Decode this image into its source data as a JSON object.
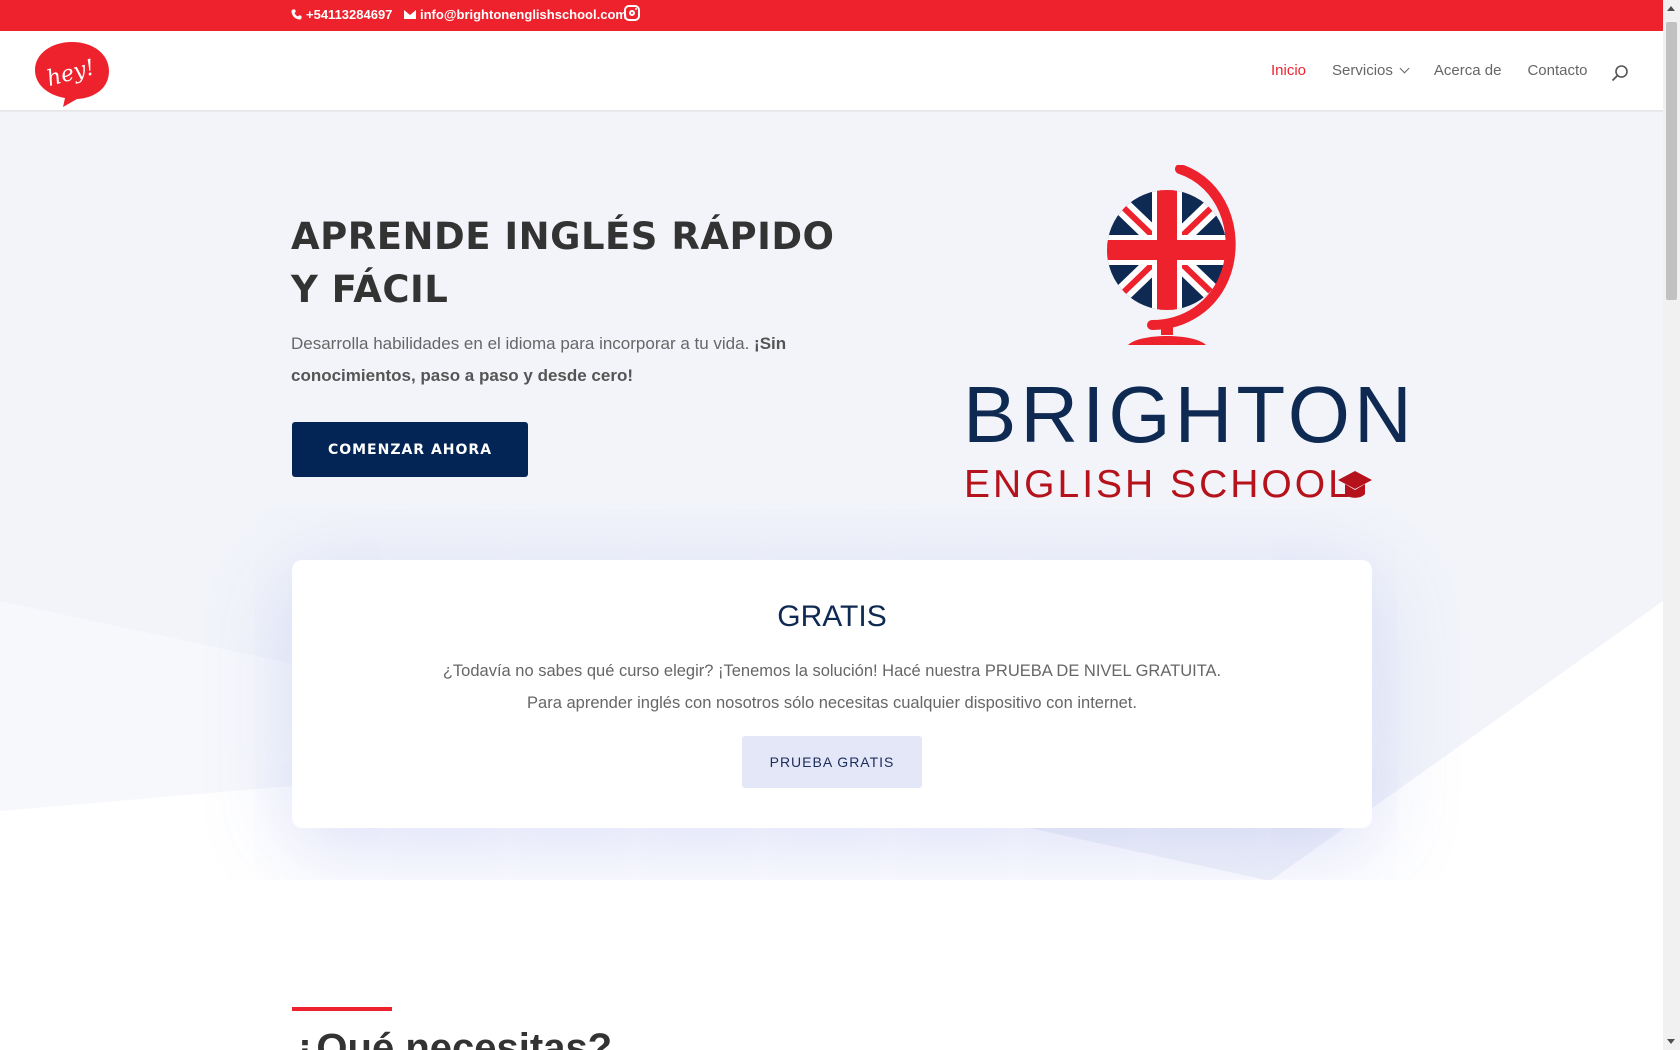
{
  "topbar": {
    "phone": "+54113284697",
    "email": "info@brightonenglishschool.com",
    "instagram_icon": "instagram-icon",
    "background": "#ee222d"
  },
  "header": {
    "logo_text": "hey!",
    "nav": [
      {
        "label": "Inicio",
        "active": true
      },
      {
        "label": "Servicios",
        "has_dropdown": true
      },
      {
        "label": "Acerca de"
      },
      {
        "label": "Contacto"
      }
    ],
    "search_icon": "search-icon"
  },
  "hero": {
    "title": "APRENDE INGLÉS RÁPIDO Y FÁCIL",
    "subtitle_plain": "Desarrolla habilidades en el idioma para incorporar a tu vida. ",
    "subtitle_bold": "¡Sin conocimientos, paso a paso y desde cero!",
    "cta_label": "COMENZAR AHORA",
    "cta_color": "#032556"
  },
  "brand": {
    "name": "BRIGHTON",
    "subname": "ENGLISH SCHOOL",
    "name_color": "#0f2a52",
    "subname_color": "#b5121b"
  },
  "free_card": {
    "title": "GRATIS",
    "text": "¿Todavía no sabes qué curso elegir? ¡Tenemos la solución! Hacé nuestra PRUEBA DE NIVEL GRATUITA. Para aprender inglés con nosotros sólo necesitas cualquier dispositivo con internet.",
    "button_label": "PRUEBA GRATIS"
  },
  "next_section": {
    "heading": "¿Qué necesitas?"
  }
}
